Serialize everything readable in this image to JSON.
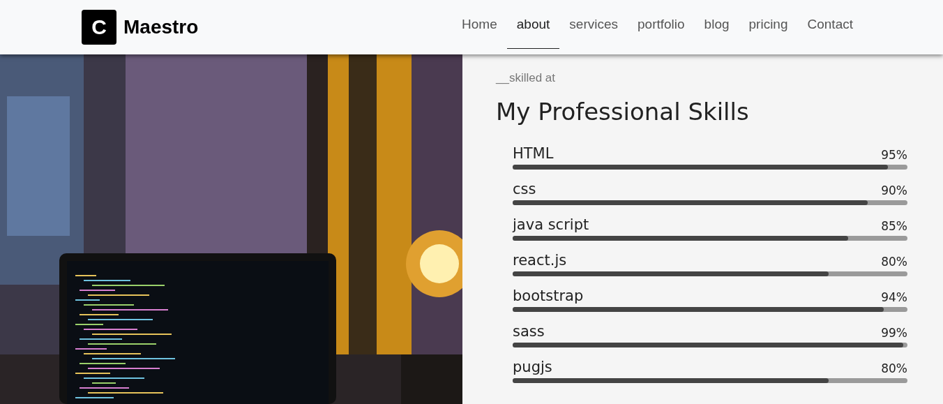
{
  "brand": {
    "logo_letter": "C",
    "name": "Maestro"
  },
  "nav": [
    {
      "label": "Home",
      "selected": false
    },
    {
      "label": "about",
      "selected": true
    },
    {
      "label": "services",
      "selected": false
    },
    {
      "label": "portfolio",
      "selected": false
    },
    {
      "label": "blog",
      "selected": false
    },
    {
      "label": "pricing",
      "selected": false
    },
    {
      "label": "Contact",
      "selected": false
    }
  ],
  "skills_section": {
    "eyebrow": "__skilled at",
    "title": "My Professional Skills",
    "skills": [
      {
        "name": "HTML",
        "reading": "95%",
        "level": 0.95
      },
      {
        "name": "css",
        "reading": "90%",
        "level": 0.9
      },
      {
        "name": "java script",
        "reading": "85%",
        "level": 0.85
      },
      {
        "name": "react.js",
        "reading": "80%",
        "level": 0.8
      },
      {
        "name": "bootstrap",
        "reading": "94%",
        "level": 0.94
      },
      {
        "name": "sass",
        "reading": "99%",
        "level": 0.99
      },
      {
        "name": "pugjs",
        "reading": "80%",
        "level": 0.8
      }
    ]
  }
}
